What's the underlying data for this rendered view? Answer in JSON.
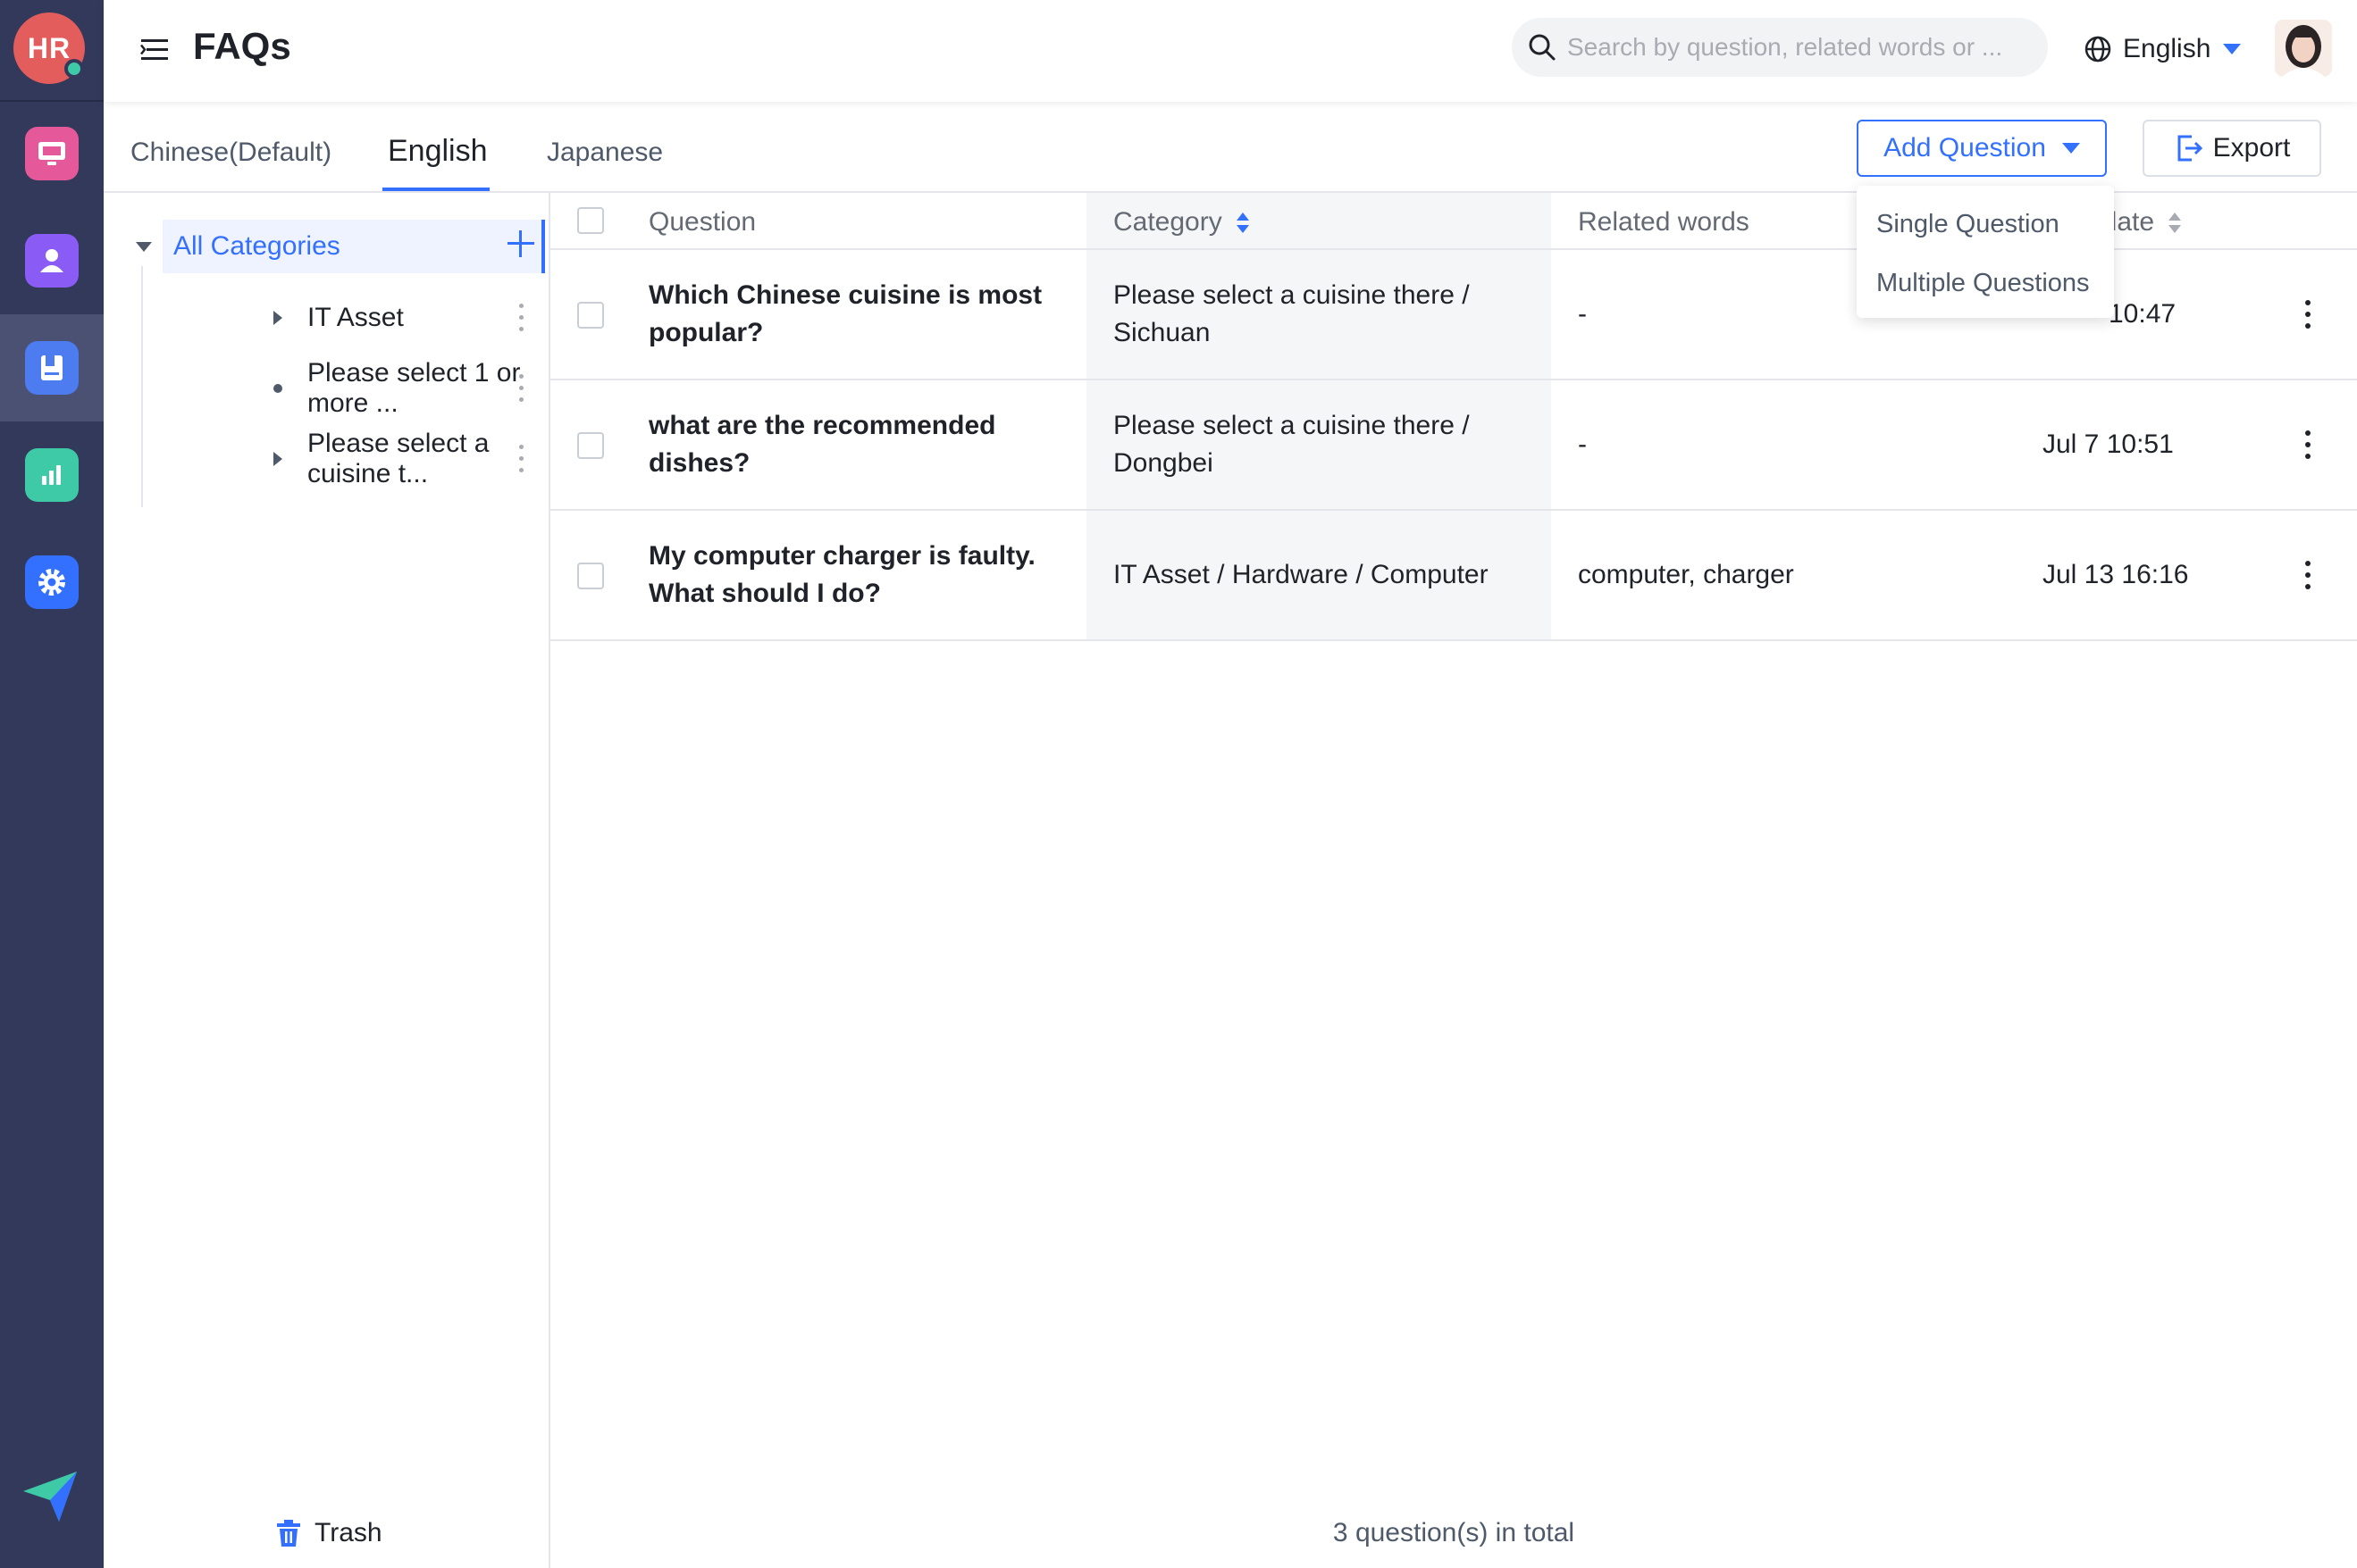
{
  "app": {
    "user_initials": "HR",
    "accent": "#3370ff",
    "rail_bg": "#33395a"
  },
  "rail": {
    "items": [
      {
        "name": "workplace-icon",
        "color": "#e5589a"
      },
      {
        "name": "employee-icon",
        "color": "#8a5cf5"
      },
      {
        "name": "faq-book-icon",
        "color": "#4d7cf0"
      },
      {
        "name": "analytics-icon",
        "color": "#3ec9a7"
      },
      {
        "name": "settings-icon",
        "color": "#3370ff"
      }
    ]
  },
  "header": {
    "title": "FAQs",
    "search_placeholder": "Search by question, related words or ...",
    "language": "English"
  },
  "tabs": [
    {
      "label": "Chinese(Default)",
      "active": false
    },
    {
      "label": "English",
      "active": true
    },
    {
      "label": "Japanese",
      "active": false
    }
  ],
  "toolbar": {
    "add_question_label": "Add Question",
    "export_label": "Export"
  },
  "add_menu": {
    "items": [
      "Single Question",
      "Multiple Questions"
    ]
  },
  "categories": {
    "all_label": "All Categories",
    "items": [
      {
        "label": "IT Asset",
        "expandable": true
      },
      {
        "label": "Please select 1 or more ...",
        "expandable": false
      },
      {
        "label": "Please select a cuisine t...",
        "expandable": true
      }
    ],
    "trash_label": "Trash"
  },
  "table": {
    "columns": [
      "Question",
      "Category",
      "Related words",
      "Last update"
    ],
    "visible_last_header": "pdate",
    "rows": [
      {
        "question": "Which Chinese cuisine is most popular?",
        "category": "Please select a cuisine there / Sichuan",
        "related": "-",
        "updated": "Jul 7 10:47",
        "updated_visible": "10:47"
      },
      {
        "question": "what are the recommended dishes?",
        "category": "Please select a cuisine there / Dongbei",
        "related": "-",
        "updated": "Jul 7 10:51",
        "updated_visible": "Jul 7 10:51"
      },
      {
        "question": "My computer charger is faulty. What should I do?",
        "category": "IT Asset / Hardware / Computer",
        "related": "computer, charger",
        "updated": "Jul 13 16:16",
        "updated_visible": "Jul 13 16:16"
      }
    ],
    "total_label": "3 question(s) in total"
  }
}
